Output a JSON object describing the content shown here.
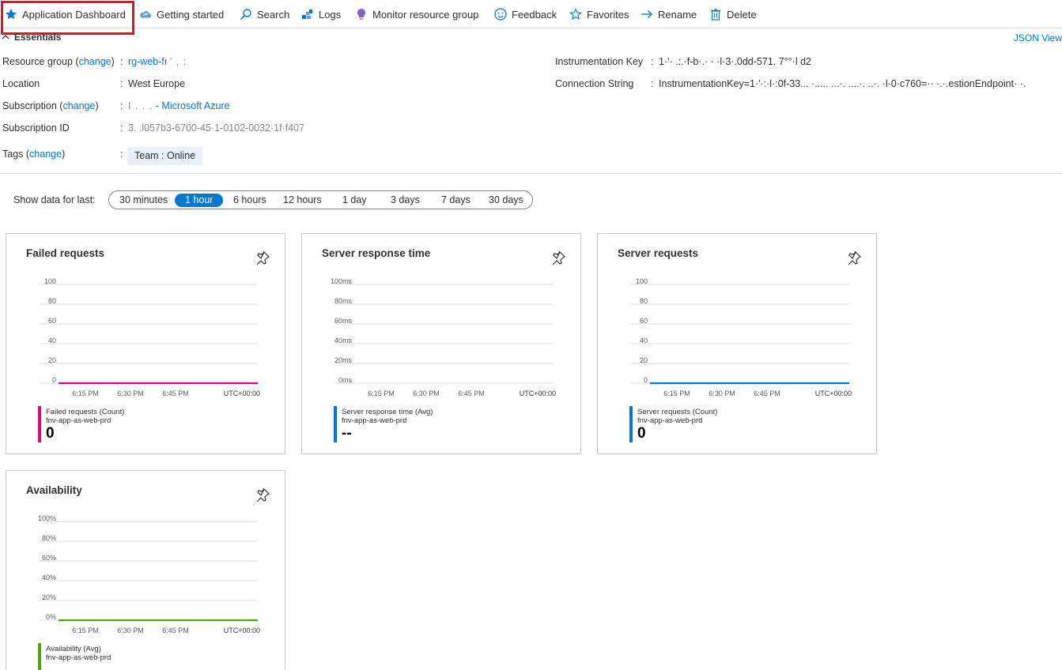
{
  "toolbar": {
    "items": [
      {
        "label": "Application Dashboard",
        "icon": "star-icon"
      },
      {
        "label": "Getting started",
        "icon": "cloud-icon"
      },
      {
        "label": "Search",
        "icon": "search-icon"
      },
      {
        "label": "Logs",
        "icon": "logs-icon"
      },
      {
        "label": "Monitor resource group",
        "icon": "bulb-icon"
      },
      {
        "label": "Feedback",
        "icon": "smiley-icon"
      },
      {
        "label": "Favorites",
        "icon": "star-outline-icon"
      },
      {
        "label": "Rename",
        "icon": "arrow-right-icon"
      },
      {
        "label": "Delete",
        "icon": "trash-icon"
      }
    ]
  },
  "essentials": {
    "heading": "Essentials",
    "json_view": "JSON View",
    "resource_group_label": "Resource group",
    "change": "change",
    "resource_group_value": "rg-web-fı",
    "resource_group_masked": "' ,  :",
    "location_label": "Location",
    "location_value": "West Europe",
    "subscription_label": "Subscription",
    "subscription_masked": "I . . .",
    "subscription_value": "- Microsoft Azure",
    "subscription_id_label": "Subscription ID",
    "subscription_id_value": "3. .l057b3-6700-45·1-0102-0032·1f·f407",
    "tags_label": "Tags",
    "tag_value": "Team : Online",
    "instrumentation_key_label": "Instrumentation Key",
    "instrumentation_key_value": "1·'·  .:.·f-b·.· ·  ·l·3·.0dd-571.   7°°·l d2",
    "connection_string_label": "Connection String",
    "connection_string_value": "InstrumentationKey=1·'·:·l·:0f-33... ·..... ...·. ....·. ..·. ·l·0·c760=·· ·.·.estionEndpoint·  ·. "
  },
  "time_range": {
    "label": "Show data for last:",
    "options": [
      "30 minutes",
      "1 hour",
      "6 hours",
      "12 hours",
      "1 day",
      "3 days",
      "7 days",
      "30 days"
    ],
    "selected": "1 hour"
  },
  "tiles": [
    {
      "title": "Failed requests",
      "legend_name": "Failed requests (Count)",
      "legend_sub": "fnv-app-as-web-prd",
      "value": "0",
      "color": "#e3008c"
    },
    {
      "title": "Server response time",
      "legend_name": "Server response time (Avg)",
      "legend_sub": "fnv-app-as-web-prd",
      "value": "--",
      "color": "#0078d4"
    },
    {
      "title": "Server requests",
      "legend_name": "Server requests (Count)",
      "legend_sub": "fnv-app-as-web-prd",
      "value": "0",
      "color": "#0078d4"
    },
    {
      "title": "Availability",
      "legend_name": "Availability (Avg)",
      "legend_sub": "fnv-app-as-web-prd",
      "value": "",
      "color": "#57a300"
    }
  ],
  "chart_data": [
    {
      "type": "line",
      "title": "Failed requests",
      "x": [
        "6:15 PM",
        "6:30 PM",
        "6:45 PM"
      ],
      "x_suffix": "UTC+00:00",
      "y_ticks": [
        "100",
        "80",
        "60",
        "40",
        "20",
        "0"
      ],
      "ylim": [
        0,
        100
      ],
      "series": [
        {
          "name": "Failed requests (Count)",
          "values": [
            0,
            0,
            0
          ]
        }
      ],
      "color": "#e3008c"
    },
    {
      "type": "line",
      "title": "Server response time",
      "x": [
        "6:15 PM",
        "6:30 PM",
        "6:45 PM"
      ],
      "x_suffix": "UTC+00:00",
      "y_ticks": [
        "100ms",
        "80ms",
        "60ms",
        "40ms",
        "20ms",
        "0ms"
      ],
      "ylim": [
        0,
        100
      ],
      "series": [
        {
          "name": "Server response time (Avg)",
          "values": []
        }
      ],
      "color": "#0078d4"
    },
    {
      "type": "line",
      "title": "Server requests",
      "x": [
        "6:15 PM",
        "6:30 PM",
        "6:45 PM"
      ],
      "x_suffix": "UTC+00:00",
      "y_ticks": [
        "100",
        "80",
        "60",
        "40",
        "20",
        "0"
      ],
      "ylim": [
        0,
        100
      ],
      "series": [
        {
          "name": "Server requests (Count)",
          "values": [
            0,
            0,
            0
          ]
        }
      ],
      "color": "#0078d4"
    },
    {
      "type": "line",
      "title": "Availability",
      "x": [
        "6:15 PM",
        "6:30 PM",
        "6:45 PM"
      ],
      "x_suffix": "UTC+00:00",
      "y_ticks": [
        "100%",
        "80%",
        "60%",
        "40%",
        "20%",
        "0%"
      ],
      "ylim": [
        0,
        100
      ],
      "series": [
        {
          "name": "Availability (Avg)",
          "values": [
            0,
            0,
            0
          ]
        }
      ],
      "color": "#57a300"
    }
  ]
}
